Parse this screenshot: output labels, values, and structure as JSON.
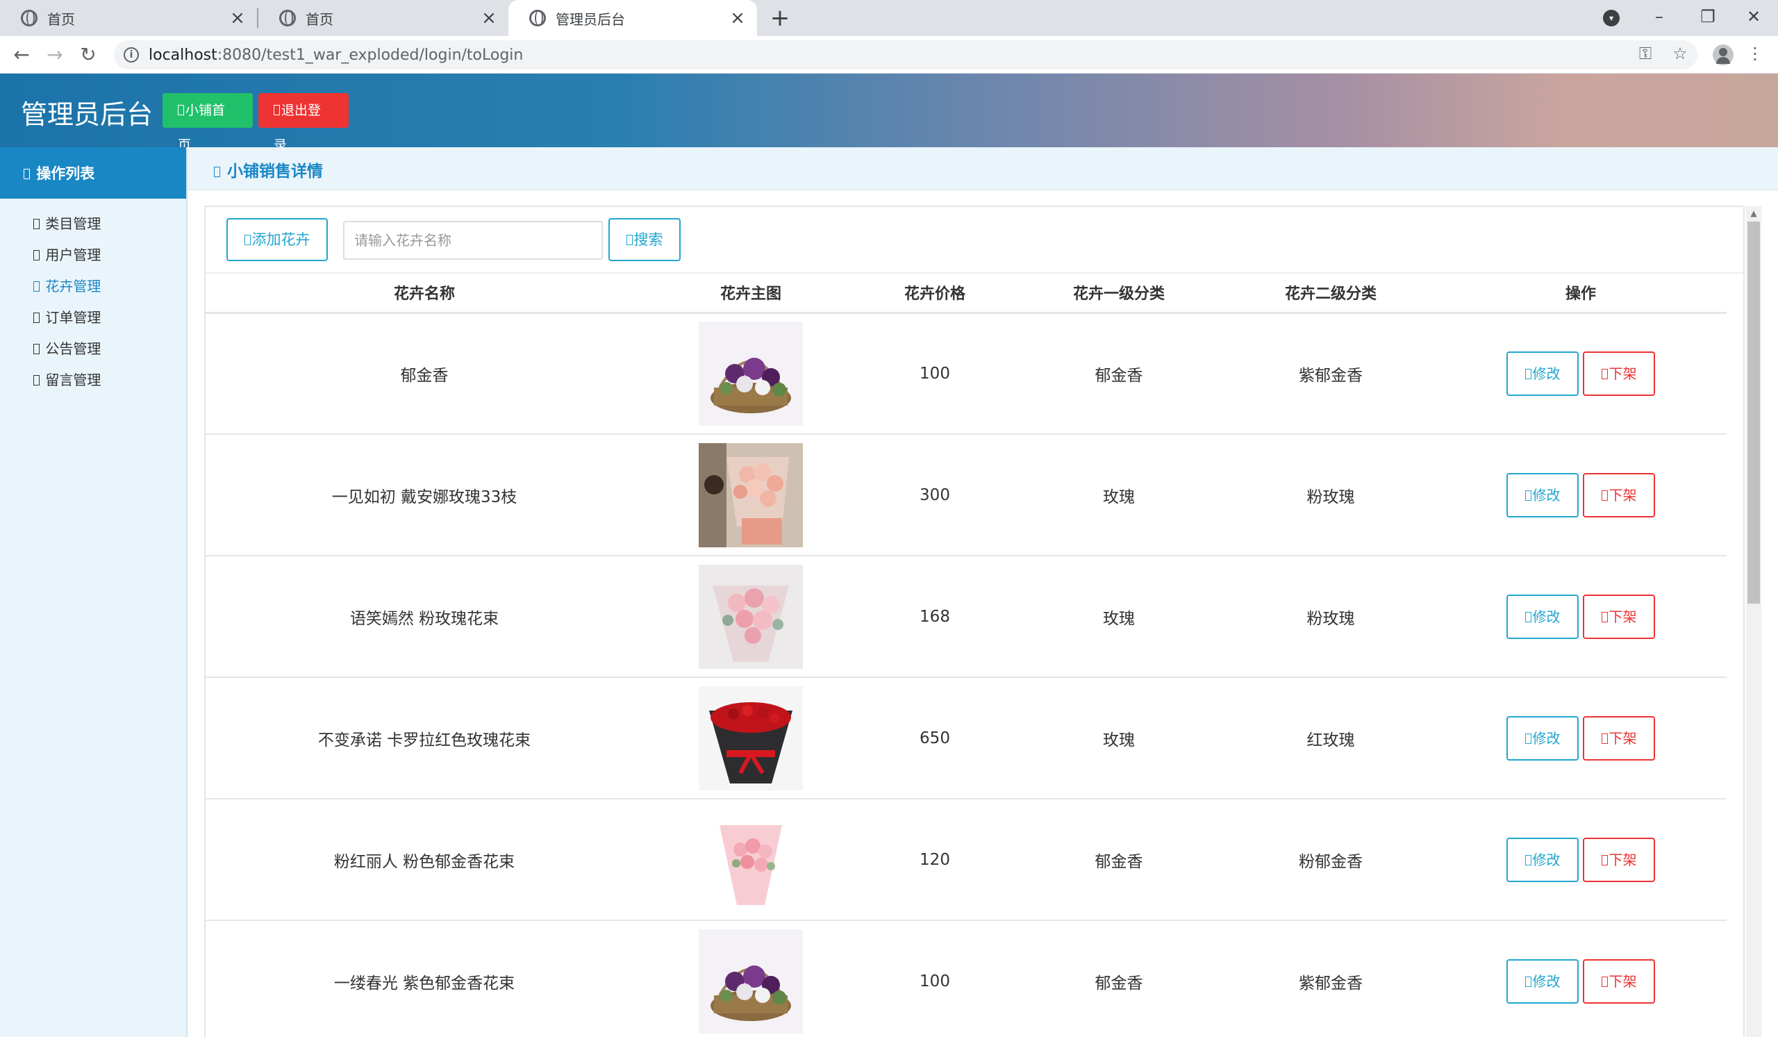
{
  "browser": {
    "tabs": [
      {
        "title": "首页"
      },
      {
        "title": "首页"
      },
      {
        "title": "管理员后台"
      }
    ],
    "url_host": "localhost",
    "url_path": ":8080/test1_war_exploded/login/toLogin"
  },
  "header": {
    "title": "管理员后台",
    "home_btn": "小铺首页",
    "logout_btn": "退出登录",
    "gradient_start": "#1c73a9",
    "gradient_end": "#c7a79c"
  },
  "sidebar": {
    "heading": "操作列表",
    "items": [
      {
        "label": "类目管理"
      },
      {
        "label": "用户管理"
      },
      {
        "label": "花卉管理"
      },
      {
        "label": "订单管理"
      },
      {
        "label": "公告管理"
      },
      {
        "label": "留言管理"
      }
    ],
    "active_index": 2,
    "accent": "#1a87c5"
  },
  "main": {
    "breadcrumb": "小铺销售详情",
    "add_btn": "添加花卉",
    "search_placeholder": "请输入花卉名称",
    "search_btn": "搜索",
    "columns": [
      "花卉名称",
      "花卉主图",
      "花卉价格",
      "花卉一级分类",
      "花卉二级分类",
      "操作"
    ],
    "edit_label": "修改",
    "off_label": "下架",
    "rows": [
      {
        "name": "郁金香",
        "price": "100",
        "cat1": "郁金香",
        "cat2": "紫郁金香",
        "img": "basket-purple"
      },
      {
        "name": "一见如初 戴安娜玫瑰33枝",
        "price": "300",
        "cat1": "玫瑰",
        "cat2": "粉玫瑰",
        "img": "bouquet-pink-hand"
      },
      {
        "name": "语笑嫣然 粉玫瑰花束",
        "price": "168",
        "cat1": "玫瑰",
        "cat2": "粉玫瑰",
        "img": "bouquet-pink"
      },
      {
        "name": "不变承诺 卡罗拉红色玫瑰花束",
        "price": "650",
        "cat1": "玫瑰",
        "cat2": "红玫瑰",
        "img": "bouquet-red"
      },
      {
        "name": "粉红丽人 粉色郁金香花束",
        "price": "120",
        "cat1": "郁金香",
        "cat2": "粉郁金香",
        "img": "bouquet-light-pink"
      },
      {
        "name": "一缕春光 紫色郁金香花束",
        "price": "100",
        "cat1": "郁金香",
        "cat2": "紫郁金香",
        "img": "basket-purple"
      }
    ],
    "edit_color": "#21a6cf",
    "off_color": "#ee3333"
  }
}
